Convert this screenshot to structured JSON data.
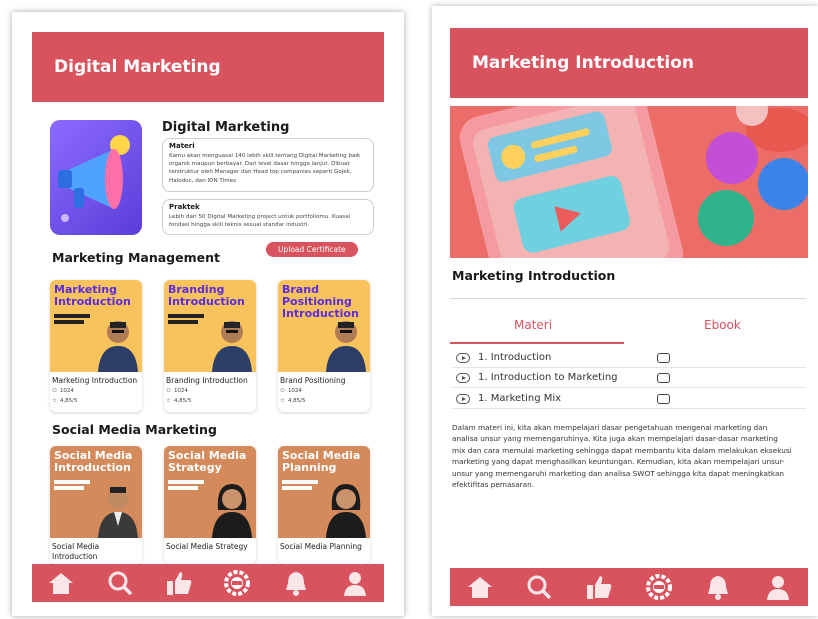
{
  "left": {
    "header_title": "Digital Marketing",
    "program_title": "Digital Marketing",
    "materi": {
      "heading": "Materi",
      "text": "Kamu akan menguasai 140 lebih skill tentang Digital Marketing baik organik maupun berbayar. Dari level dasar hingga lanjut. Dibuat terstruktur oleh Manager dan Head top companies seperti Gojek, Halodoc, dan IDN Times"
    },
    "praktek": {
      "heading": "Praktek",
      "text": "Lebih dari 50 Digital Marketing project untuk portfoliomu. Kuasai fondasi hingga skill teknis sesuai standar industri."
    },
    "section1_title": "Marketing Management",
    "upload_label": "Upload Certificate",
    "courses1": [
      {
        "thumb_title": "Marketing Introduction",
        "caption": "Marketing Introduction",
        "students": "1024",
        "rating": "4,85/5"
      },
      {
        "thumb_title": "Branding Introduction",
        "caption": "Branding Introduction",
        "students": "1024",
        "rating": "4,85/5"
      },
      {
        "thumb_title": "Brand Positioning Introduction",
        "caption": "Brand Positioning",
        "students": "1024",
        "rating": "4,85/5"
      }
    ],
    "section2_title": "Social Media Marketing",
    "courses2": [
      {
        "thumb_title": "Social Media Introduction",
        "caption": "Social Media Introduction"
      },
      {
        "thumb_title": "Social Media Strategy",
        "caption": "Social Media Strategy"
      },
      {
        "thumb_title": "Social Media Planning",
        "caption": "Social Media Planning"
      }
    ]
  },
  "right": {
    "header_title": "Marketing Introduction",
    "content_title": "Marketing Introduction",
    "tabs": [
      "Materi",
      "Ebook"
    ],
    "lessons": [
      "1. Introduction",
      "1. Introduction to Marketing",
      "1. Marketing Mix"
    ],
    "description": "Dalam materi ini, kita akan mempelajari dasar pengetahuan mengenai marketing dan analisa unsur yang memengaruhinya. Kita juga akan mempelajari dasar-dasar marketing mix dan cara memulai marketing sehingga dapat membantu kita dalam melakukan eksekusi marketing yang dapat menghasilkan keuntungan. Kemudian, kita akan mempelajari unsur-unsur yang memengaruhi marketing dan analisa SWOT sehingga kita dapat meningkatkan efektifitas pemasaran."
  },
  "nav_icons": [
    "home-icon",
    "search-icon",
    "thumbs-up-icon",
    "settings-icon",
    "bell-icon",
    "profile-icon"
  ],
  "colors": {
    "accent": "#d9535e",
    "yellow_card": "#f8c35c",
    "orange_card": "#d48a5a"
  }
}
